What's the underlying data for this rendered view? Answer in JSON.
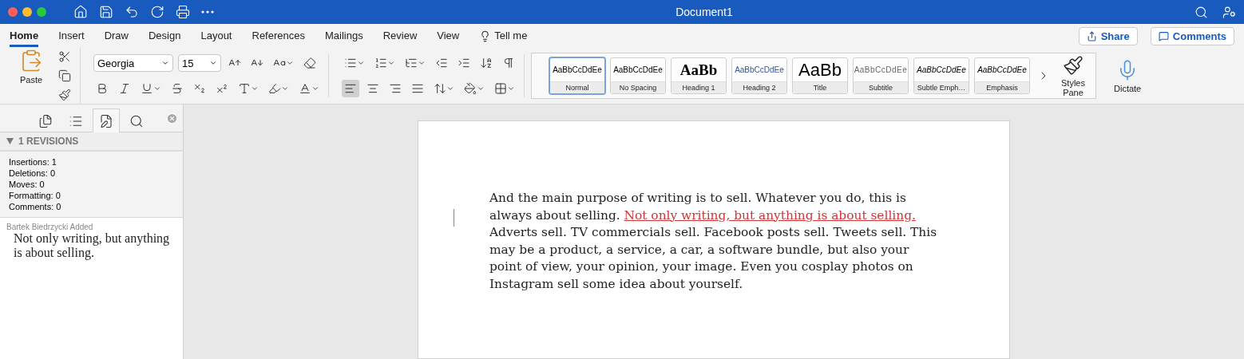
{
  "window": {
    "title": "Document1"
  },
  "ribbon_tabs": [
    {
      "label": "Home",
      "selected": true
    },
    {
      "label": "Insert",
      "selected": false
    },
    {
      "label": "Draw",
      "selected": false
    },
    {
      "label": "Design",
      "selected": false
    },
    {
      "label": "Layout",
      "selected": false
    },
    {
      "label": "References",
      "selected": false
    },
    {
      "label": "Mailings",
      "selected": false
    },
    {
      "label": "Review",
      "selected": false
    },
    {
      "label": "View",
      "selected": false
    }
  ],
  "tell_me": "Tell me",
  "share": "Share",
  "comments": "Comments",
  "paste": "Paste",
  "font": {
    "name": "Georgia",
    "size": "15"
  },
  "alignment": [
    {
      "kind": "left",
      "selected": true
    },
    {
      "kind": "center",
      "selected": false
    },
    {
      "kind": "right",
      "selected": false
    },
    {
      "kind": "justify",
      "selected": false
    }
  ],
  "styles": [
    {
      "kind": "normal",
      "preview": "AaBbCcDdEe",
      "label": "Normal",
      "selected": true
    },
    {
      "kind": "normal",
      "preview": "AaBbCcDdEe",
      "label": "No Spacing",
      "selected": false
    },
    {
      "kind": "heading1",
      "preview": "AaBb",
      "label": "Heading 1",
      "selected": false
    },
    {
      "kind": "heading2",
      "preview": "AaBbCcDdEe",
      "label": "Heading 2",
      "selected": false
    },
    {
      "kind": "title",
      "preview": "AaBb",
      "label": "Title",
      "selected": false
    },
    {
      "kind": "subtitle",
      "preview": "AaBbCcDdEe",
      "label": "Subtitle",
      "selected": false
    },
    {
      "kind": "subtle",
      "preview": "AaBbCcDdEe",
      "label": "Subtle Emph…",
      "selected": false
    },
    {
      "kind": "emphasis",
      "preview": "AaBbCcDdEe",
      "label": "Emphasis",
      "selected": false
    }
  ],
  "styles_pane": "Styles Pane",
  "dictate": "Dictate",
  "sidebar": {
    "tabs": [
      {
        "kind": "thumbnails",
        "selected": false
      },
      {
        "kind": "outline",
        "selected": false
      },
      {
        "kind": "revisions",
        "selected": true
      },
      {
        "kind": "search",
        "selected": false
      }
    ],
    "header": "1 REVISIONS",
    "expanded": true,
    "stats": [
      "Insertions: 1",
      "Deletions: 0",
      "Moves: 0",
      "Formatting: 0",
      "Comments: 0"
    ],
    "revision": {
      "author": "Bartek Biedrzycki Added",
      "text": "Not only writing, but anything is about selling."
    }
  },
  "document": {
    "before": "And the main purpose of writing is to sell. Whatever you do, this is always about selling.",
    "inserted": "Not only writing, but anything is about selling.",
    "after": "Adverts sell. TV commercials sell. Facebook posts sell. Tweets sell. This may be a product, a service, a car, a software bundle, but also your point of view, your opinion, your image. Even you cosplay photos on Instagram sell some idea about yourself."
  }
}
